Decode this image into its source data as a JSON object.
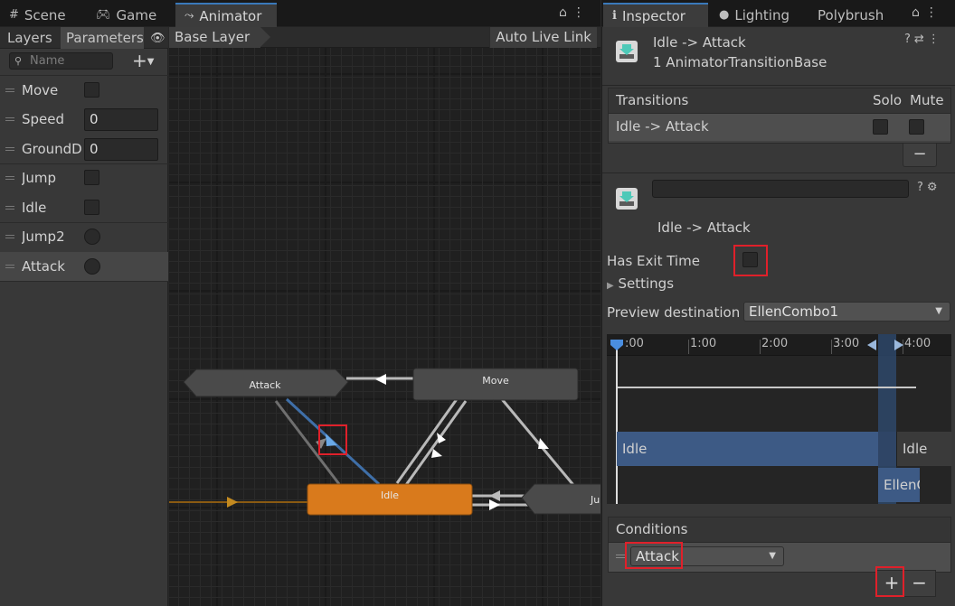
{
  "left_tabbar": {
    "tabs": [
      {
        "label": "Scene",
        "icon": "grid-icon"
      },
      {
        "label": "Game",
        "icon": "gamepad-icon"
      },
      {
        "label": "Animator",
        "icon": "animator-icon"
      }
    ],
    "active": "Animator"
  },
  "right_tabbar": {
    "tabs": [
      {
        "label": "Inspector",
        "icon": "info-icon"
      },
      {
        "label": "Lighting",
        "icon": "lightbulb-icon"
      },
      {
        "label": "Polybrush",
        "icon": ""
      }
    ],
    "active": "Inspector"
  },
  "params_panel": {
    "tabs": [
      "Layers",
      "Parameters"
    ],
    "active_tab": "Parameters",
    "search_placeholder": "Name",
    "params": [
      {
        "name": "Move",
        "type": "bool"
      },
      {
        "name": "Speed",
        "type": "float",
        "value": "0"
      },
      {
        "name": "GroundDi",
        "type": "float",
        "value": "0"
      },
      {
        "name": "Jump",
        "type": "bool"
      },
      {
        "name": "Idle",
        "type": "bool"
      },
      {
        "name": "Jump2",
        "type": "trigger"
      },
      {
        "name": "Attack",
        "type": "trigger",
        "selected": true
      }
    ]
  },
  "graph": {
    "breadcrumb": "Base Layer",
    "auto_live_link": "Auto Live Link",
    "states": {
      "attack": "Attack",
      "move": "Move",
      "idle": "Idle",
      "jump_partial": "Ju"
    }
  },
  "inspector": {
    "title": "Idle -> Attack",
    "subtitle": "1 AnimatorTransitionBase",
    "transitions_header": "Transitions",
    "solo_label": "Solo",
    "mute_label": "Mute",
    "transition_row": "Idle -> Attack",
    "remove_label": "−",
    "transition_name": "Idle -> Attack",
    "has_exit_time_label": "Has Exit Time",
    "settings_label": "Settings",
    "preview_label": "Preview destination s",
    "preview_value": "EllenCombo1",
    "timeline_ticks": [
      ":00",
      "1:00",
      "2:00",
      "3:00",
      "4:00"
    ],
    "clip_source": "Idle",
    "clip_source_repeat": "Idle",
    "clip_dest": "EllenC",
    "conditions_header": "Conditions",
    "condition_param": "Attack",
    "add_label": "+",
    "remove_condition_label": "−"
  },
  "colors": {
    "accent": "#3a79bb",
    "idle_state": "#d97a1c",
    "highlight": "#e0202a"
  }
}
